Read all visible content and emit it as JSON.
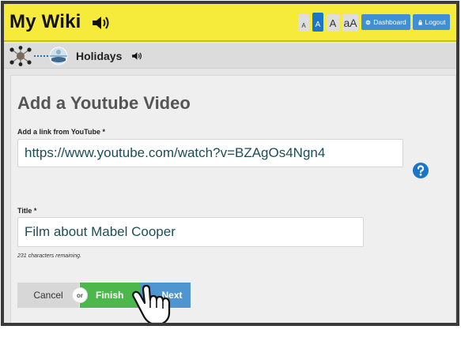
{
  "header": {
    "app_title": "My Wiki",
    "font_size_buttons": [
      "A",
      "A",
      "A",
      "aA"
    ],
    "dashboard_label": "Dashboard",
    "logout_label": "Logout",
    "accent_color": "#f6ea3a",
    "primary_color": "#1976c9"
  },
  "subheader": {
    "section_title": "Holidays"
  },
  "form": {
    "page_title": "Add a Youtube Video",
    "link_label": "Add a link from YouTube *",
    "link_value": "https://www.youtube.com/watch?v=BZAgOs4Ngn4",
    "title_label": "Title *",
    "title_value": "Film about Mabel Cooper",
    "chars_remaining": "231 characters remaining.",
    "cancel_label": "Cancel",
    "or_label": "or",
    "finish_label": "Finish",
    "next_label": "Next",
    "finish_color": "#4cb84c",
    "next_color": "#4f95cf"
  },
  "icons": {
    "speaker": "speaker-icon",
    "help": "help-icon",
    "network": "network-icon",
    "globe": "globe-icon",
    "pointer": "hand-pointer-icon"
  }
}
